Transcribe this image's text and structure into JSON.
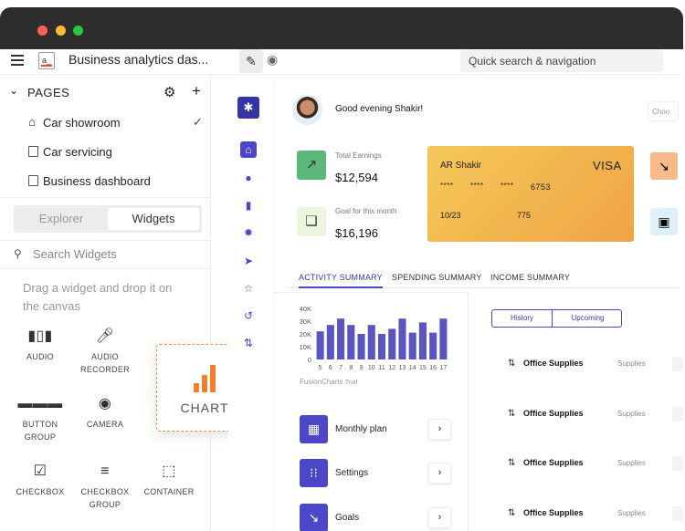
{
  "app": {
    "title": "Business analytics das...",
    "logo_text": "a_",
    "quick_search": "Quick search & navigation"
  },
  "pages": {
    "header": "PAGES",
    "items": [
      {
        "label": "Car showroom",
        "checked": true
      },
      {
        "label": "Car servicing",
        "checked": false
      },
      {
        "label": "Business dashboard",
        "checked": false
      }
    ]
  },
  "panel": {
    "tabs": [
      "Explorer",
      "Widgets"
    ],
    "active_tab": "Widgets",
    "search_placeholder": "Search Widgets",
    "hint": "Drag a widget and drop it on the canvas"
  },
  "widgets": [
    {
      "label": "AUDIO",
      "icon": "audio-icon"
    },
    {
      "label": "AUDIO RECORDER",
      "icon": "microphone-icon"
    },
    {
      "label": "BUTTON GROUP",
      "icon": "button-group-icon"
    },
    {
      "label": "CAMERA",
      "icon": "camera-icon"
    },
    {
      "label": "CHECKBOX",
      "icon": "checkbox-icon"
    },
    {
      "label": "CHECKBOX GROUP",
      "icon": "checkbox-group-icon"
    },
    {
      "label": "CONTAINER",
      "icon": "container-icon"
    }
  ],
  "dragging": {
    "label": "CHART",
    "icon": "bar-chart-icon",
    "color": "#f57c2a"
  },
  "dashboard": {
    "greeting": "Good evening Shakir!",
    "partial_button": "Choo",
    "stats": [
      {
        "label": "Total Earnings",
        "value": "$12,594",
        "color": "#5cb87a"
      },
      {
        "label": "Goal for this month",
        "value": "$16,196",
        "color": "#eef5df"
      }
    ],
    "card": {
      "holder": "AR Shakir",
      "brand": "VISA",
      "number_groups": [
        "****",
        "****",
        "****",
        "6753"
      ],
      "expiry": "10/23",
      "cvv": "775"
    },
    "tabs": [
      "ACTIVITY SUMMARY",
      "SPENDING SUMMARY",
      "INCOME SUMMARY"
    ],
    "active_tab": "ACTIVITY SUMMARY",
    "fusion_label": "FusionCharts",
    "fusion_trial": "Trial",
    "menu": [
      {
        "label": "Monthly plan",
        "icon": "calendar-icon"
      },
      {
        "label": "Settings",
        "icon": "sliders-icon"
      },
      {
        "label": "Goals",
        "icon": "trend-down-icon"
      }
    ],
    "toggle": [
      "History",
      "Upcoming"
    ],
    "transactions": [
      {
        "title": "Office Supplies",
        "category": "Supplies"
      },
      {
        "title": "Office Supplies",
        "category": "Supplies"
      },
      {
        "title": "Office Supplies",
        "category": "Supplies"
      },
      {
        "title": "Office Supplies",
        "category": "Supplies"
      }
    ],
    "accent": "#4b47c9"
  },
  "chart_data": {
    "type": "bar",
    "categories": [
      "5",
      "6",
      "7",
      "8",
      "9",
      "10",
      "11",
      "12",
      "13",
      "14",
      "15",
      "16",
      "17"
    ],
    "values": [
      22000,
      27000,
      32000,
      27000,
      20000,
      27000,
      20000,
      24000,
      32000,
      21000,
      29000,
      21000,
      32000
    ],
    "y_ticks": [
      "40K",
      "30K",
      "20K",
      "10K",
      "0"
    ],
    "ylim": [
      0,
      40000
    ],
    "color": "#5b55c2"
  }
}
